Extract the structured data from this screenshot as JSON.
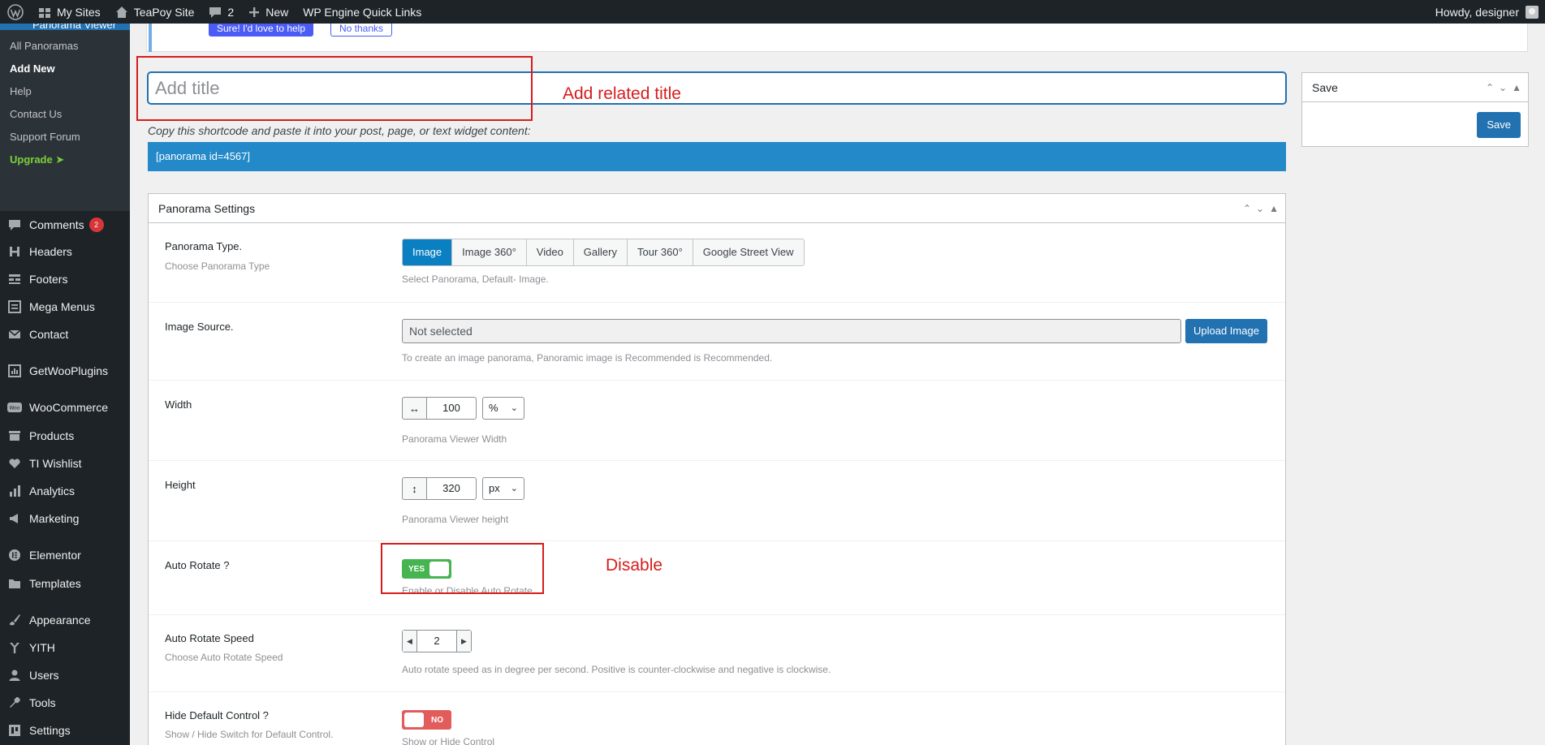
{
  "admin_bar": {
    "my_sites": "My Sites",
    "site_name": "TeaPoy Site",
    "comments_count": "2",
    "new_label": "New",
    "quick_links": "WP Engine Quick Links",
    "howdy": "Howdy, designer"
  },
  "sidebar": {
    "current_menu": "Panorama Viewer",
    "submenu": [
      "All Panoramas",
      "Add New",
      "Help",
      "Contact Us",
      "Support Forum",
      "Upgrade"
    ],
    "items": [
      {
        "label": "Comments",
        "icon": "comment-icon",
        "badge": "2"
      },
      {
        "label": "Headers",
        "icon": "header-icon"
      },
      {
        "label": "Footers",
        "icon": "footer-icon"
      },
      {
        "label": "Mega Menus",
        "icon": "mega-menu-icon"
      },
      {
        "label": "Contact",
        "icon": "mail-icon"
      },
      {
        "label": "GetWooPlugins",
        "icon": "plugin-icon"
      },
      {
        "label": "WooCommerce",
        "icon": "woo-icon"
      },
      {
        "label": "Products",
        "icon": "archive-icon"
      },
      {
        "label": "TI Wishlist",
        "icon": "heart-icon"
      },
      {
        "label": "Analytics",
        "icon": "chart-icon"
      },
      {
        "label": "Marketing",
        "icon": "megaphone-icon"
      },
      {
        "label": "Elementor",
        "icon": "elementor-icon"
      },
      {
        "label": "Templates",
        "icon": "folder-icon"
      },
      {
        "label": "Appearance",
        "icon": "brush-icon"
      },
      {
        "label": "YITH",
        "icon": "yith-icon"
      },
      {
        "label": "Users",
        "icon": "user-icon"
      },
      {
        "label": "Tools",
        "icon": "wrench-icon"
      },
      {
        "label": "Settings",
        "icon": "settings-icon"
      }
    ]
  },
  "notice": {
    "help_button": "Sure! I'd love to help",
    "no_button": "No thanks"
  },
  "editor": {
    "title_placeholder": "Add title",
    "title_annotation": "Add related title",
    "shortcode_note": "Copy this shortcode and paste it into your post, page, or text widget content:",
    "shortcode": "[panorama id=4567]"
  },
  "save_box": {
    "title": "Save",
    "button": "Save"
  },
  "settings": {
    "title": "Panorama Settings",
    "type": {
      "label": "Panorama Type.",
      "sublabel": "Choose Panorama Type",
      "options": [
        "Image",
        "Image 360°",
        "Video",
        "Gallery",
        "Tour 360°",
        "Google Street View"
      ],
      "selected": "Image",
      "help": "Select Panorama, Default- Image."
    },
    "source": {
      "label": "Image Source.",
      "value": "Not selected",
      "button": "Upload Image",
      "help": "To create an image panorama, Panoramic image is Recommended is Recommended."
    },
    "width": {
      "label": "Width",
      "value": "100",
      "unit": "%",
      "help": "Panorama Viewer Width"
    },
    "height": {
      "label": "Height",
      "value": "320",
      "unit": "px",
      "help": "Panorama Viewer height"
    },
    "auto_rotate": {
      "label": "Auto Rotate ?",
      "toggle": "YES",
      "help": "Enable or Disable Auto Rotate",
      "annotation": "Disable"
    },
    "rotate_speed": {
      "label": "Auto Rotate Speed",
      "sublabel": "Choose Auto Rotate Speed",
      "value": "2",
      "help": "Auto rotate speed as in degree per second. Positive is counter-clockwise and negative is clockwise."
    },
    "hide_control": {
      "label": "Hide Default Control ?",
      "sublabel": "Show / Hide Switch for Default Control.",
      "toggle": "NO",
      "help": "Show or Hide Control"
    }
  },
  "colors": {
    "admin_dark": "#1d2327",
    "primary_blue": "#2271b1",
    "shortcode_blue": "#2389c8",
    "annotation_red": "#d71c1c",
    "toggle_green": "#46b450",
    "toggle_red": "#e25c5c"
  }
}
